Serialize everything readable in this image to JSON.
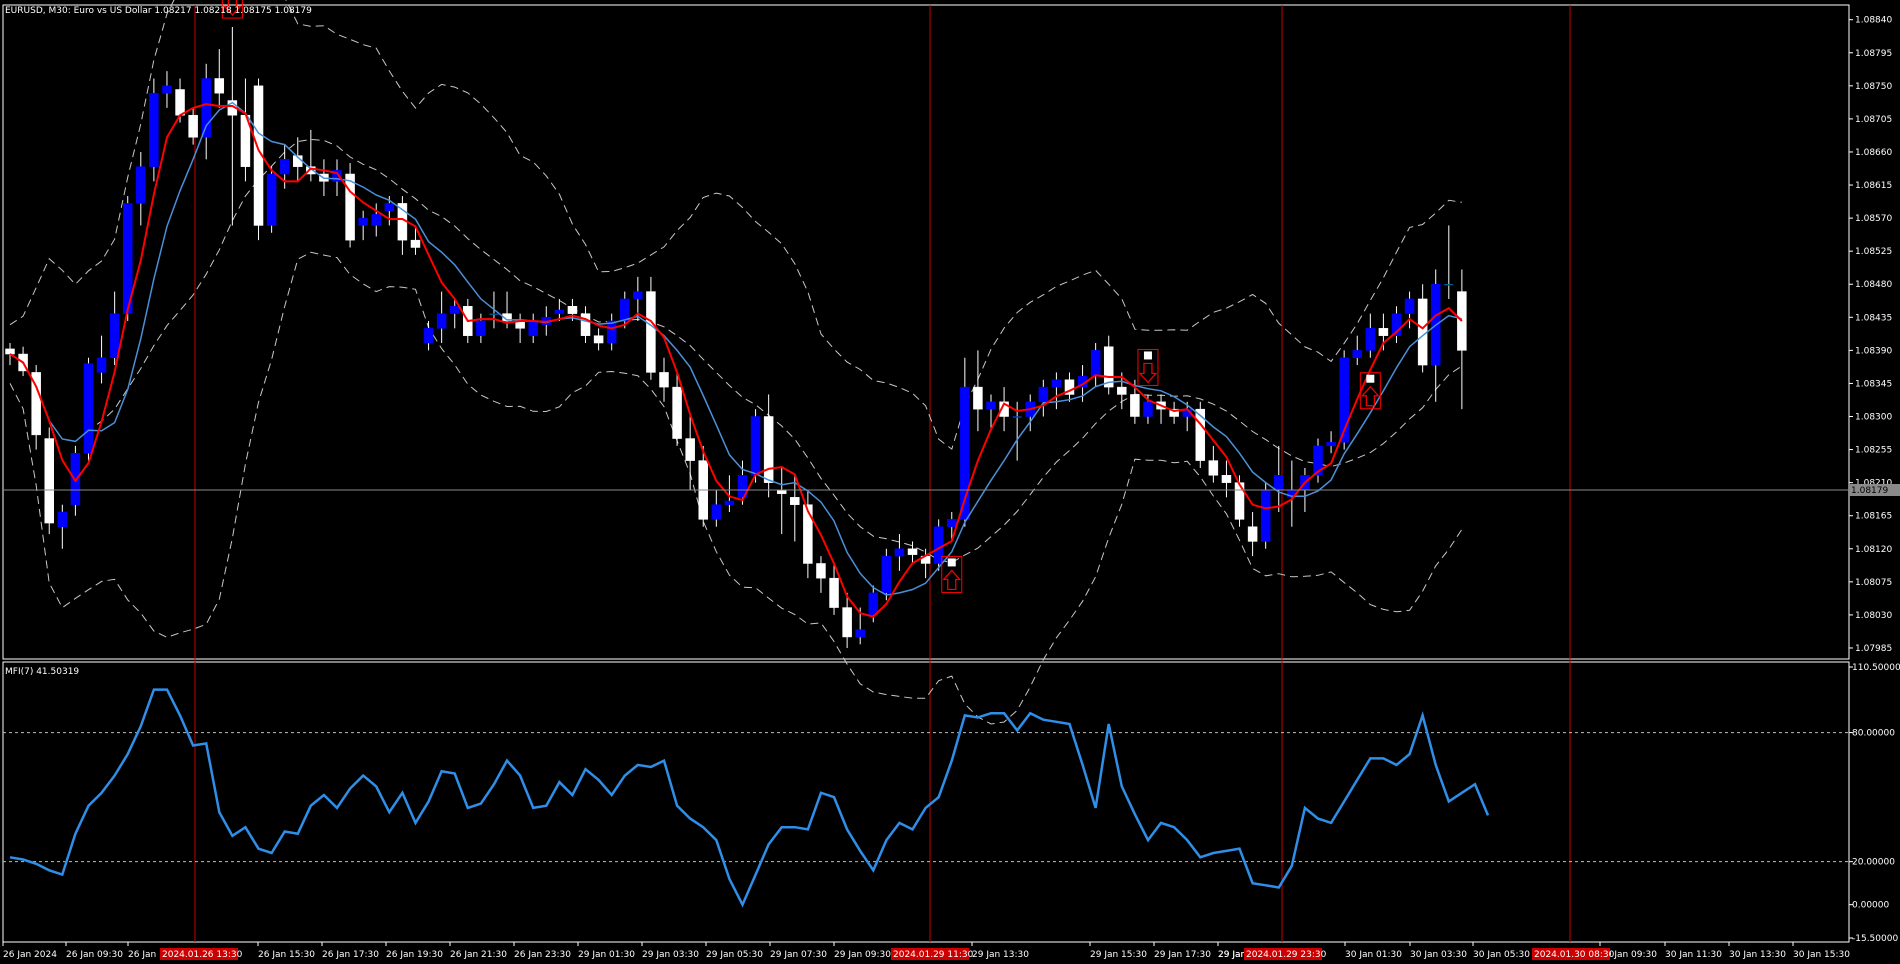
{
  "header": {
    "title": "EURUSD, M30:  Euro vs US Dollar  1.08217 1.08218 1.08175 1.08179"
  },
  "indicator": {
    "title": "MFI(7) 41.50319"
  },
  "price_axis": {
    "labels": [
      "1.08840",
      "1.08795",
      "1.08750",
      "1.08705",
      "1.08660",
      "1.08615",
      "1.08570",
      "1.08525",
      "1.08480",
      "1.08435",
      "1.08390",
      "1.08345",
      "1.08300",
      "1.08255",
      "1.08210",
      "1.08165",
      "1.08120",
      "1.08075",
      "1.08030",
      "1.07985"
    ],
    "current_price_label": "1.08179"
  },
  "indicator_axis": {
    "labels": [
      "110.50000",
      "80.00000",
      "20.00000",
      "0.00000",
      "-15.50000"
    ]
  },
  "time_axis": {
    "labels": [
      "26 Jan 2024",
      "26 Jan 09:30",
      "26 Jan",
      "26 Jan 15:30",
      "26 Jan 17:30",
      "26 Jan 19:30",
      "26 Jan 21:30",
      "26 Jan 23:30",
      "29 Jan 01:30",
      "29 Jan 03:30",
      "29 Jan 05:30",
      "29 Jan 07:30",
      "29 Jan 09:30",
      "29 Jan 13:30",
      "29 Jan 15:30",
      "29 Jan 17:30",
      "29 Jan 19:30",
      "29 Jan",
      "30 Jan 01:30",
      "30 Jan 03:30",
      "30 Jan 05:30",
      "30 Jan 09:30",
      "30 Jan 11:30",
      "30 Jan 13:30",
      "30 Jan 15:30"
    ],
    "markers": [
      "2024.01.26 13:30",
      "2024.01.29 11:30",
      "2024.01.29 23:30",
      "2024.01.30 08:30"
    ]
  },
  "colors": {
    "background": "#000000",
    "bull_candle": "#0000ff",
    "bear_candle": "#ffffff",
    "doji": "#00cc00",
    "red_ma": "#ff0000",
    "blue_ma": "#4a90d9",
    "bands": "#c8c8c8",
    "mfi_line": "#2f8fe8",
    "vline": "#cc0000",
    "grid": "#808080"
  },
  "chart_data": {
    "type": "candlestick",
    "symbol": "EURUSD",
    "timeframe": "M30",
    "ylim": [
      1.0797,
      1.0886
    ],
    "ohlc": [
      [
        1.08392,
        1.084,
        1.0837,
        1.08385
      ],
      [
        1.08385,
        1.08395,
        1.08355,
        1.08362
      ],
      [
        1.0836,
        1.0837,
        1.08255,
        1.08275
      ],
      [
        1.0827,
        1.08285,
        1.0814,
        1.08155
      ],
      [
        1.0815,
        1.0818,
        1.0812,
        1.0817
      ],
      [
        1.0818,
        1.0826,
        1.08165,
        1.0825
      ],
      [
        1.0825,
        1.0838,
        1.0824,
        1.08372
      ],
      [
        1.0836,
        1.0841,
        1.08345,
        1.0838
      ],
      [
        1.0838,
        1.0847,
        1.0837,
        1.0844
      ],
      [
        1.0844,
        1.086,
        1.0843,
        1.0859
      ],
      [
        1.0859,
        1.0866,
        1.0856,
        1.0864
      ],
      [
        1.0864,
        1.0876,
        1.0862,
        1.0874
      ],
      [
        1.0874,
        1.0877,
        1.0872,
        1.0875
      ],
      [
        1.08745,
        1.0876,
        1.087,
        1.0871
      ],
      [
        1.0871,
        1.0872,
        1.0867,
        1.0868
      ],
      [
        1.0868,
        1.0878,
        1.0865,
        1.0876
      ],
      [
        1.0876,
        1.088,
        1.0872,
        1.0874
      ],
      [
        1.0873,
        1.0883,
        1.0856,
        1.0871
      ],
      [
        1.0871,
        1.0876,
        1.0862,
        1.0864
      ],
      [
        1.0875,
        1.0876,
        1.0854,
        1.0856
      ],
      [
        1.0856,
        1.0864,
        1.0855,
        1.0863
      ],
      [
        1.0863,
        1.0867,
        1.0861,
        1.0865
      ],
      [
        1.08655,
        1.0868,
        1.0862,
        1.0864
      ],
      [
        1.0864,
        1.0869,
        1.0862,
        1.0863
      ],
      [
        1.0863,
        1.0865,
        1.086,
        1.0862
      ],
      [
        1.0862,
        1.0865,
        1.086,
        1.08635
      ],
      [
        1.0863,
        1.08645,
        1.0853,
        1.0854
      ],
      [
        1.0856,
        1.0858,
        1.0854,
        1.0857
      ],
      [
        1.0856,
        1.0859,
        1.08545,
        1.08575
      ],
      [
        1.0858,
        1.086,
        1.0856,
        1.0859
      ],
      [
        1.0859,
        1.086,
        1.0852,
        1.0854
      ],
      [
        1.0854,
        1.0856,
        1.0852,
        1.0853
      ],
      [
        1.084,
        1.0843,
        1.0839,
        1.0842
      ],
      [
        1.0842,
        1.0847,
        1.084,
        1.0844
      ],
      [
        1.0844,
        1.0846,
        1.0842,
        1.0845
      ],
      [
        1.0845,
        1.0846,
        1.084,
        1.0841
      ],
      [
        1.0841,
        1.0844,
        1.084,
        1.0843
      ],
      [
        1.0844,
        1.0847,
        1.0842,
        1.0844
      ],
      [
        1.0844,
        1.0847,
        1.0842,
        1.0843
      ],
      [
        1.0843,
        1.0844,
        1.084,
        1.0842
      ],
      [
        1.0841,
        1.0844,
        1.084,
        1.0843
      ],
      [
        1.08425,
        1.0845,
        1.0841,
        1.08435
      ],
      [
        1.0844,
        1.0846,
        1.0843,
        1.08445
      ],
      [
        1.0845,
        1.0846,
        1.0843,
        1.0844
      ],
      [
        1.0844,
        1.0845,
        1.084,
        1.0841
      ],
      [
        1.0841,
        1.0842,
        1.0839,
        1.084
      ],
      [
        1.084,
        1.0844,
        1.0839,
        1.0843
      ],
      [
        1.0843,
        1.0847,
        1.0842,
        1.0846
      ],
      [
        1.0846,
        1.0849,
        1.0843,
        1.0847
      ],
      [
        1.0847,
        1.0849,
        1.0835,
        1.0836
      ],
      [
        1.0836,
        1.0838,
        1.0832,
        1.0834
      ],
      [
        1.0834,
        1.0836,
        1.0826,
        1.0827
      ],
      [
        1.0827,
        1.083,
        1.082,
        1.0824
      ],
      [
        1.0824,
        1.0826,
        1.0815,
        1.0816
      ],
      [
        1.0816,
        1.082,
        1.0815,
        1.0818
      ],
      [
        1.0818,
        1.0822,
        1.0817,
        1.08185
      ],
      [
        1.0819,
        1.0824,
        1.0818,
        1.0822
      ],
      [
        1.0822,
        1.0831,
        1.0821,
        1.083
      ],
      [
        1.083,
        1.0833,
        1.0819,
        1.0821
      ],
      [
        1.082,
        1.0823,
        1.0814,
        1.08195
      ],
      [
        1.0819,
        1.0822,
        1.0813,
        1.0818
      ],
      [
        1.0818,
        1.082,
        1.0808,
        1.081
      ],
      [
        1.081,
        1.0811,
        1.0806,
        1.0808
      ],
      [
        1.0808,
        1.081,
        1.0803,
        1.0804
      ],
      [
        1.0804,
        1.0806,
        1.07985,
        1.08
      ],
      [
        1.08,
        1.0804,
        1.0799,
        1.0801
      ],
      [
        1.0803,
        1.0807,
        1.0802,
        1.0806
      ],
      [
        1.0806,
        1.0812,
        1.0805,
        1.0811
      ],
      [
        1.0811,
        1.0814,
        1.0809,
        1.0812
      ],
      [
        1.0812,
        1.0813,
        1.081,
        1.08112
      ],
      [
        1.0811,
        1.0812,
        1.0808,
        1.081
      ],
      [
        1.081,
        1.0816,
        1.0809,
        1.0815
      ],
      [
        1.0815,
        1.0817,
        1.0813,
        1.0816
      ],
      [
        1.0816,
        1.0838,
        1.0815,
        1.0834
      ],
      [
        1.0834,
        1.0839,
        1.0828,
        1.0831
      ],
      [
        1.0831,
        1.0833,
        1.0828,
        1.0832
      ],
      [
        1.0832,
        1.0834,
        1.0828,
        1.083
      ],
      [
        1.083,
        1.0832,
        1.0824,
        1.083
      ],
      [
        1.083,
        1.0833,
        1.0828,
        1.0832
      ],
      [
        1.0832,
        1.0835,
        1.083,
        1.0834
      ],
      [
        1.0834,
        1.0836,
        1.0831,
        1.0835
      ],
      [
        1.0835,
        1.0836,
        1.0832,
        1.0833
      ],
      [
        1.0834,
        1.0837,
        1.0832,
        1.08355
      ],
      [
        1.08355,
        1.084,
        1.0834,
        1.0839
      ],
      [
        1.08395,
        1.0841,
        1.0833,
        1.0834
      ],
      [
        1.0834,
        1.0836,
        1.0831,
        1.0833
      ],
      [
        1.0833,
        1.0835,
        1.0829,
        1.083
      ],
      [
        1.083,
        1.0833,
        1.0829,
        1.0832
      ],
      [
        1.0832,
        1.0833,
        1.0829,
        1.0831
      ],
      [
        1.0831,
        1.0832,
        1.0829,
        1.083
      ],
      [
        1.083,
        1.0832,
        1.0828,
        1.0831
      ],
      [
        1.0831,
        1.0832,
        1.0823,
        1.0824
      ],
      [
        1.0824,
        1.0826,
        1.0821,
        1.0822
      ],
      [
        1.0822,
        1.0824,
        1.0819,
        1.0821
      ],
      [
        1.0821,
        1.0822,
        1.0815,
        1.0816
      ],
      [
        1.0815,
        1.0817,
        1.0811,
        1.0813
      ],
      [
        1.0813,
        1.0821,
        1.0812,
        1.082
      ],
      [
        1.082,
        1.0826,
        1.0817,
        1.0822
      ],
      [
        1.0819,
        1.0824,
        1.0815,
        1.082
      ],
      [
        1.082,
        1.0823,
        1.0817,
        1.0822
      ],
      [
        1.0822,
        1.0827,
        1.0821,
        1.0826
      ],
      [
        1.0826,
        1.0828,
        1.0825,
        1.08265
      ],
      [
        1.08265,
        1.0839,
        1.08255,
        1.0838
      ],
      [
        1.0838,
        1.0841,
        1.0837,
        1.0839
      ],
      [
        1.0839,
        1.0844,
        1.0838,
        1.0842
      ],
      [
        1.0842,
        1.0844,
        1.0839,
        1.0841
      ],
      [
        1.0841,
        1.0845,
        1.084,
        1.0844
      ],
      [
        1.0844,
        1.0847,
        1.0842,
        1.0846
      ],
      [
        1.0846,
        1.0848,
        1.0836,
        1.0837
      ],
      [
        1.0837,
        1.085,
        1.0832,
        1.0848
      ],
      [
        1.0848,
        1.0856,
        1.0846,
        1.0848
      ],
      [
        1.0847,
        1.085,
        1.0831,
        1.0839
      ]
    ],
    "mfi": [
      22,
      21,
      19,
      16,
      14,
      33,
      46,
      52,
      60,
      70,
      83,
      100,
      100,
      88,
      74,
      75,
      43,
      32,
      36,
      26,
      24,
      34,
      33,
      46,
      51,
      45,
      54,
      60,
      55,
      43,
      52,
      38,
      48,
      62,
      61,
      45,
      47,
      56,
      67,
      60,
      45,
      46,
      57,
      51,
      63,
      58,
      51,
      60,
      65,
      64,
      67,
      46,
      40,
      36,
      30,
      12,
      0,
      14,
      28,
      36,
      36,
      35,
      52,
      50,
      35,
      25,
      16,
      30,
      38,
      35,
      45,
      50,
      67,
      88,
      87,
      89,
      89,
      81,
      89,
      86,
      85,
      84,
      65,
      45,
      84,
      55,
      42,
      30,
      38,
      36,
      30,
      22,
      24,
      25,
      26,
      10,
      9,
      8,
      18,
      45,
      40,
      38,
      48,
      58,
      68,
      68,
      65,
      70,
      88,
      65,
      48,
      52,
      56,
      41.5
    ],
    "mfi_levels": [
      80,
      20
    ],
    "mfi_ylim": [
      -15.5,
      110.5
    ]
  }
}
